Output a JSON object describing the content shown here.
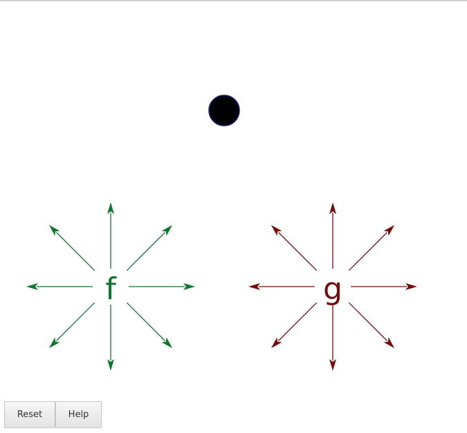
{
  "ball": {
    "fill": "#000000",
    "stroke": "#1a1a8c"
  },
  "arrows": [
    {
      "label": "f",
      "color": "#0a7a2a"
    },
    {
      "label": "g",
      "color": "#7a0a0a"
    }
  ],
  "buttons": {
    "reset_label": "Reset",
    "help_label": "Help"
  }
}
